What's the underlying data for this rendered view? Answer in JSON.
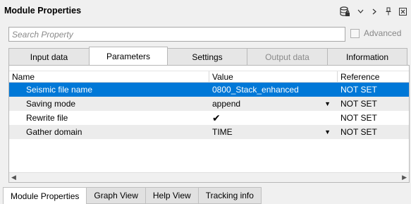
{
  "window": {
    "title": "Module Properties",
    "toolbar_icons": [
      "database-lock-icon",
      "chevron-down-icon",
      "chevron-right-icon",
      "pin-icon",
      "close-icon"
    ]
  },
  "search": {
    "placeholder": "Search Property",
    "value": ""
  },
  "advanced": {
    "label": "Advanced",
    "checked": false
  },
  "tabs": [
    {
      "label": "Input data"
    },
    {
      "label": "Parameters",
      "active": true
    },
    {
      "label": "Settings"
    },
    {
      "label": "Output data",
      "disabled": true
    },
    {
      "label": "Information"
    }
  ],
  "table": {
    "columns": [
      "Name",
      "Value",
      "Reference"
    ],
    "rows": [
      {
        "name": "Seismic file name",
        "value": "0800_Stack_enhanced",
        "reference": "NOT SET",
        "selected": true
      },
      {
        "name": "Saving mode",
        "value": "append",
        "reference": "NOT SET",
        "dropdown": true
      },
      {
        "name": "Rewrite file",
        "value": "✔",
        "reference": "NOT SET",
        "checkbox": true
      },
      {
        "name": "Gather domain",
        "value": "TIME",
        "reference": "NOT SET",
        "dropdown": true
      }
    ]
  },
  "bottom_tabs": [
    {
      "label": "Module Properties",
      "active": true
    },
    {
      "label": "Graph View"
    },
    {
      "label": "Help View"
    },
    {
      "label": "Tracking info"
    }
  ],
  "colors": {
    "selection": "#0078d7",
    "alt_row": "#ececec"
  }
}
